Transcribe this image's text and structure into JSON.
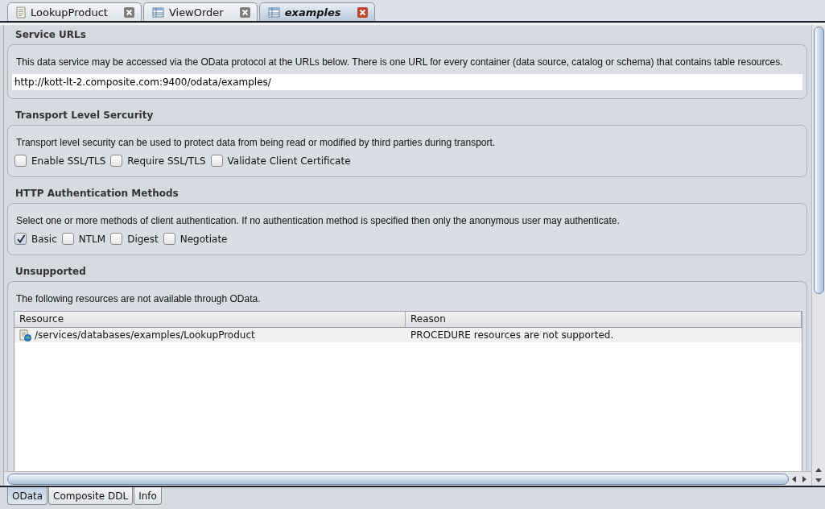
{
  "tabs": [
    {
      "label": "LookupProduct",
      "kind": "document",
      "selected": false
    },
    {
      "label": "ViewOrder",
      "kind": "table",
      "selected": false
    },
    {
      "label": "examples",
      "kind": "table",
      "selected": true
    }
  ],
  "sections": [
    {
      "title": "Service URLs",
      "description": "This data service may be accessed via the OData protocol at the URLs below. There is one URL for every container (data source, catalog or schema) that contains table resources.",
      "url": "http://kott-lt-2.composite.com:9400/odata/examples/"
    },
    {
      "title": "Transport Level Sercurity",
      "description": "Transport level security can be used to protect data from being read or modified by third parties during transport.",
      "options": [
        {
          "label": "Enable SSL/TLS",
          "checked": false
        },
        {
          "label": "Require SSL/TLS",
          "checked": false
        },
        {
          "label": "Validate Client Certificate",
          "checked": false
        }
      ]
    },
    {
      "title": "HTTP Authentication Methods",
      "description": "Select one or more methods of client authentication. If no authentication method is specified then only the anonymous user may authenticate.",
      "options": [
        {
          "label": "Basic",
          "checked": true
        },
        {
          "label": "NTLM",
          "checked": false
        },
        {
          "label": "Digest",
          "checked": false
        },
        {
          "label": "Negotiate",
          "checked": false
        }
      ]
    }
  ],
  "unsupported": {
    "title": "Unsupported",
    "description": "The following resources are not available through OData.",
    "table": {
      "columns": [
        "Resource",
        "Reason"
      ],
      "rows": [
        {
          "resource": "/services/databases/examples/LookupProduct",
          "reason": "PROCEDURE resources are not supported."
        }
      ]
    }
  },
  "bottom_tabs": [
    {
      "label": "OData",
      "selected": true
    },
    {
      "label": "Composite DDL",
      "selected": false
    },
    {
      "label": "Info",
      "selected": false
    }
  ]
}
